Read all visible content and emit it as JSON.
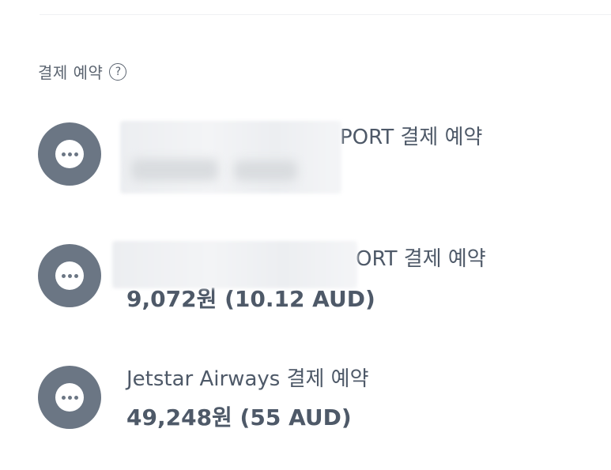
{
  "section": {
    "title": "결제 예약",
    "help_glyph": "?"
  },
  "items": [
    {
      "merchant": "PORT 결제 예약",
      "amount": "",
      "icon": "more-dots-icon"
    },
    {
      "merchant": "ORT 결제 예약",
      "amount": "9,072원 (10.12 AUD)",
      "icon": "more-dots-icon"
    },
    {
      "merchant": "Jetstar Airways 결제 예약",
      "amount": "49,248원 (55 AUD)",
      "icon": "more-dots-icon"
    }
  ],
  "colors": {
    "avatar": "#6b7684",
    "text": "#4e5968"
  }
}
